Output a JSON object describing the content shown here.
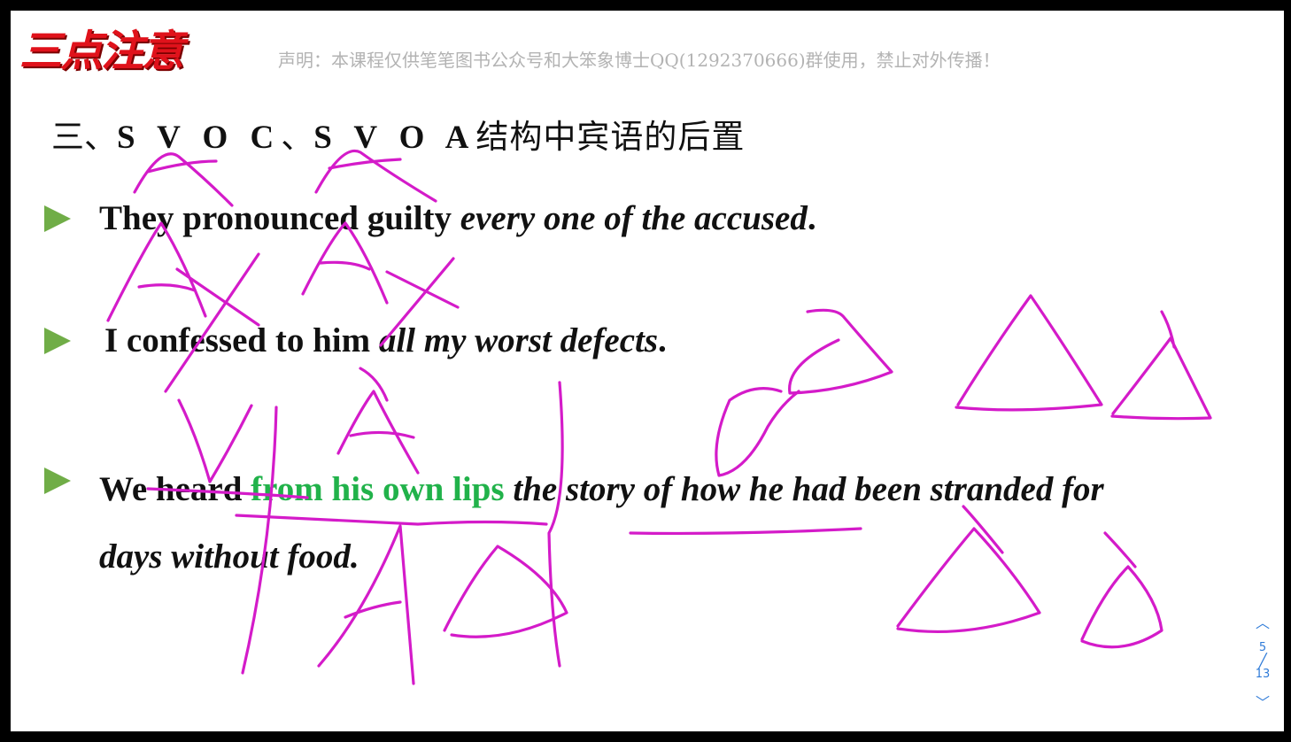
{
  "logo": {
    "text": "三点注意"
  },
  "disclaimer": "声明：本课程仅供笔笔图书公众号和大笨象博士QQ(1292370666)群使用，禁止对外传播！",
  "heading": {
    "prefix": "三、",
    "code1": "S V O C",
    "sep": "、",
    "code2": "S V O A",
    "suffix": "结构中宾语的后置"
  },
  "sentences": [
    {
      "p1": "They  pronounced  guilty  ",
      "p2": "every one of the accused",
      "p3": "."
    },
    {
      "p1": "I  confessed  to him  ",
      "p2": "all my worst defects",
      "p3": "."
    },
    {
      "p1": "We  heard  ",
      "green": "from his own lips",
      "p2": "  the story of how he had been stranded for",
      "line2": "days without food."
    }
  ],
  "pager": {
    "prev_icon": "chevron-up-icon",
    "next_icon": "chevron-down-icon",
    "current": "5",
    "total": "13"
  },
  "colors": {
    "bullet": "#70ad47",
    "ink": "#d41bc9",
    "logo": "#e0121b",
    "highlight": "#21b24a"
  }
}
